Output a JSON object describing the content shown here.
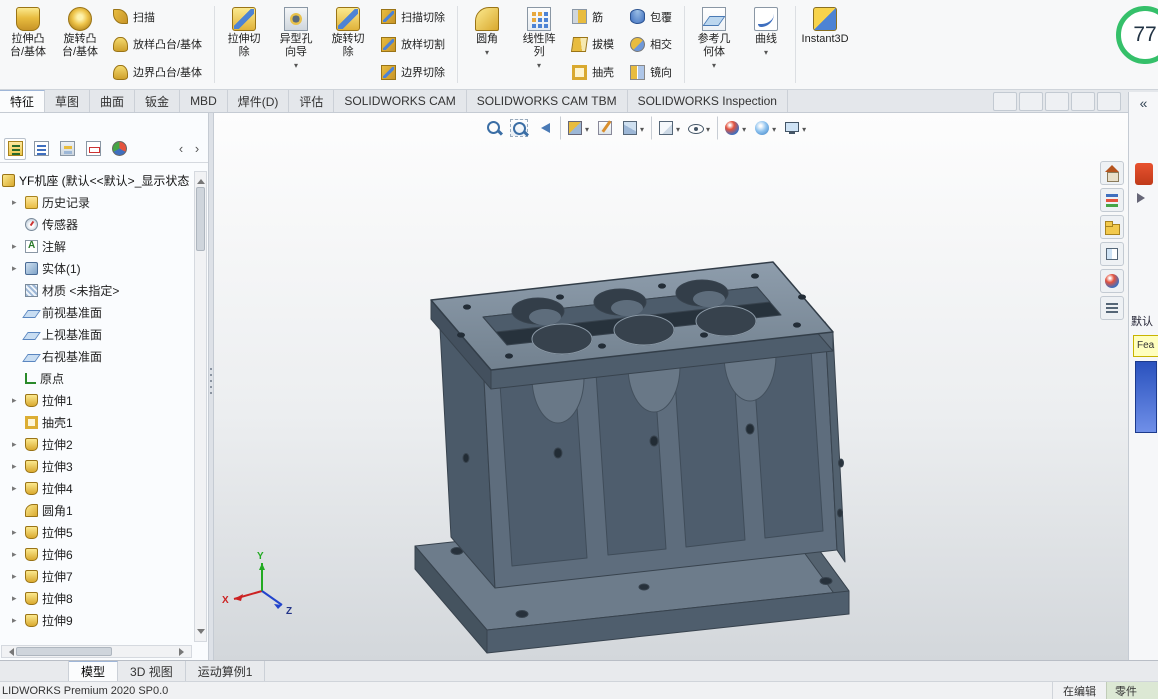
{
  "ribbon_tabs": {
    "items": [
      "特征",
      "草图",
      "曲面",
      "钣金",
      "MBD",
      "焊件(D)",
      "评估",
      "SOLIDWORKS CAM",
      "SOLIDWORKS CAM TBM",
      "SOLIDWORKS Inspection"
    ],
    "active": "特征"
  },
  "ribbon": {
    "extrude_boss": {
      "l1": "拉伸凸",
      "l2": "台/基体"
    },
    "revolve_boss": {
      "l1": "旋转凸",
      "l2": "台/基体"
    },
    "sweep": "扫描",
    "loft_boss": "放样凸台/基体",
    "boundary_boss": "边界凸台/基体",
    "extrude_cut": {
      "l1": "拉伸切",
      "l2": "除"
    },
    "hole_wizard": {
      "l1": "异型孔",
      "l2": "向导"
    },
    "revolve_cut": {
      "l1": "旋转切",
      "l2": "除"
    },
    "sweep_cut": "扫描切除",
    "loft_cut": "放样切割",
    "boundary_cut": "边界切除",
    "fillet": "圆角",
    "linear_pattern": {
      "l1": "线性阵",
      "l2": "列"
    },
    "rib": "筋",
    "draft": "拔模",
    "shell": "抽壳",
    "wrap": "包覆",
    "intersect": "相交",
    "mirror": "镜向",
    "ref_geometry": {
      "l1": "参考几",
      "l2": "何体"
    },
    "curves": "曲线",
    "instant3d": "Instant3D"
  },
  "manager_tabs": {
    "items": [
      {
        "name": "feature-manager"
      },
      {
        "name": "property-manager"
      },
      {
        "name": "configuration-manager"
      },
      {
        "name": "dimxpert-manager"
      },
      {
        "name": "display-manager"
      }
    ]
  },
  "feature_tree": {
    "root": "YF机座 (默认<<默认>_显示状态 :",
    "items": [
      {
        "label": "历史记录",
        "icon": "history",
        "expand": true
      },
      {
        "label": "传感器",
        "icon": "sensors",
        "expand": false
      },
      {
        "label": "注解",
        "icon": "annotations",
        "expand": true
      },
      {
        "label": "实体(1)",
        "icon": "solid-bodies",
        "expand": true
      },
      {
        "label": "材质 <未指定>",
        "icon": "material",
        "expand": false
      },
      {
        "label": "前视基准面",
        "icon": "plane",
        "expand": false
      },
      {
        "label": "上视基准面",
        "icon": "plane",
        "expand": false
      },
      {
        "label": "右视基准面",
        "icon": "plane",
        "expand": false
      },
      {
        "label": "原点",
        "icon": "origin",
        "expand": false
      },
      {
        "label": "拉伸1",
        "icon": "extrude",
        "expand": true
      },
      {
        "label": "抽壳1",
        "icon": "shell",
        "expand": false
      },
      {
        "label": "拉伸2",
        "icon": "extrude",
        "expand": true
      },
      {
        "label": "拉伸3",
        "icon": "extrude",
        "expand": true
      },
      {
        "label": "拉伸4",
        "icon": "extrude",
        "expand": true
      },
      {
        "label": "圆角1",
        "icon": "fillet",
        "expand": false
      },
      {
        "label": "拉伸5",
        "icon": "extrude",
        "expand": true
      },
      {
        "label": "拉伸6",
        "icon": "extrude",
        "expand": true
      },
      {
        "label": "拉伸7",
        "icon": "extrude",
        "expand": true
      },
      {
        "label": "拉伸8",
        "icon": "extrude",
        "expand": true
      },
      {
        "label": "拉伸9",
        "icon": "extrude",
        "expand": true
      }
    ]
  },
  "headsup": {
    "items": [
      {
        "name": "zoom-fit"
      },
      {
        "name": "zoom-area"
      },
      {
        "name": "previous-view"
      },
      {
        "name": "section-view",
        "caret": true
      },
      {
        "name": "annotation-view"
      },
      {
        "name": "view-orientation",
        "caret": true
      },
      {
        "name": "display-style",
        "caret": true
      },
      {
        "name": "hide-show-items",
        "caret": true
      },
      {
        "name": "edit-appearance",
        "caret": true
      },
      {
        "name": "apply-scene",
        "caret": true
      },
      {
        "name": "view-settings",
        "caret": true
      }
    ]
  },
  "taskpane": {
    "items": [
      {
        "name": "home"
      },
      {
        "name": "design-library"
      },
      {
        "name": "file-explorer"
      },
      {
        "name": "view-palette"
      },
      {
        "name": "appearances"
      },
      {
        "name": "custom-properties"
      }
    ],
    "default_label": "默认",
    "fea_label": "Fea"
  },
  "doc_window": {
    "items": [
      {
        "name": "dock-left"
      },
      {
        "name": "dock-right"
      },
      {
        "name": "minimize"
      },
      {
        "name": "restore"
      },
      {
        "name": "close"
      }
    ]
  },
  "doc_nav": {
    "items": [
      {
        "name": "first-tab"
      },
      {
        "name": "prev-tab"
      },
      {
        "name": "next-tab"
      },
      {
        "name": "last-tab"
      }
    ]
  },
  "doc_tabs": {
    "items": [
      "模型",
      "3D 视图",
      "运动算例1"
    ],
    "active": "模型"
  },
  "viewport": {
    "triad": {
      "x": "X",
      "y": "Y",
      "z": "Z"
    }
  },
  "perf": {
    "value": "77"
  },
  "status": {
    "left": "LIDWORKS Premium 2020 SP0.0",
    "editing": "在编辑",
    "doc_type": "零件"
  }
}
